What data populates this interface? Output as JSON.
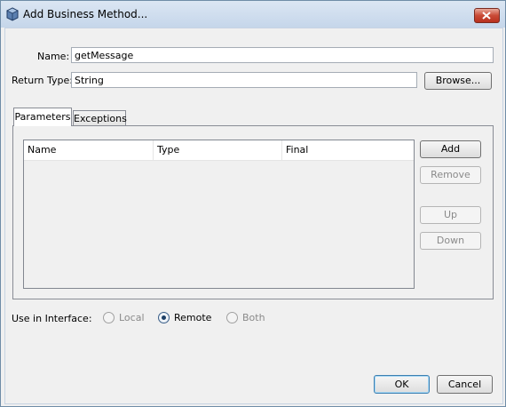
{
  "dialog": {
    "title": "Add Business Method...",
    "icon": "cube-icon"
  },
  "form": {
    "name_label": "Name:",
    "name_value": "getMessage",
    "return_type_label": "Return Type:",
    "return_type_value": "String",
    "browse_label": "Browse..."
  },
  "tabs": [
    {
      "label": "Parameters",
      "active": true
    },
    {
      "label": "Exceptions",
      "active": false
    }
  ],
  "table": {
    "columns": [
      "Name",
      "Type",
      "Final"
    ],
    "rows": []
  },
  "side_buttons": {
    "add": "Add",
    "remove": "Remove",
    "up": "Up",
    "down": "Down"
  },
  "interface": {
    "label": "Use in Interface:",
    "options": [
      {
        "label": "Local",
        "selected": false,
        "enabled": false
      },
      {
        "label": "Remote",
        "selected": true,
        "enabled": true
      },
      {
        "label": "Both",
        "selected": false,
        "enabled": false
      }
    ]
  },
  "footer": {
    "ok": "OK",
    "cancel": "Cancel"
  },
  "colors": {
    "close_button": "#c94a36",
    "title_bar": "#c5d6ea"
  }
}
